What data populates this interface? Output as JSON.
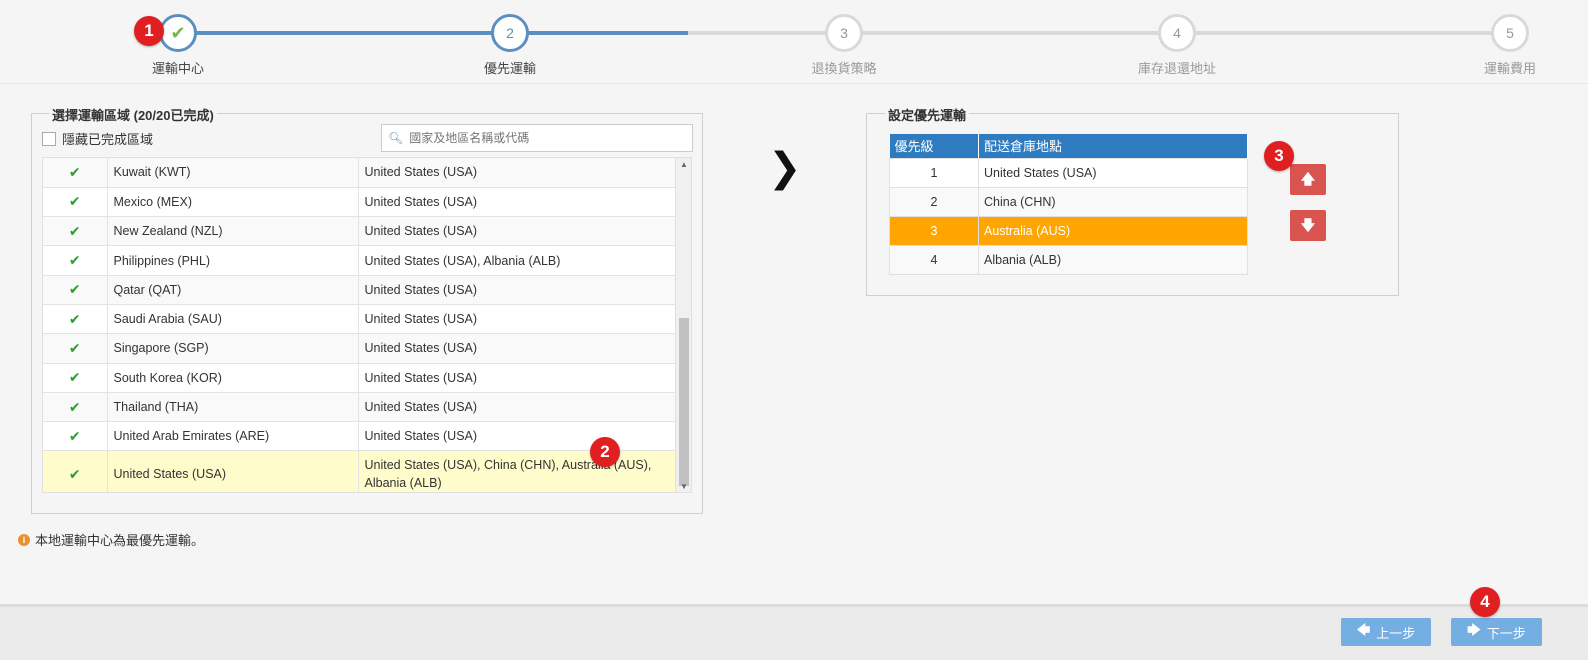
{
  "steps": [
    {
      "number": "1",
      "label": "運輸中心",
      "status": "done",
      "icon": "check-icon"
    },
    {
      "number": "2",
      "label": "優先運輸",
      "status": "active"
    },
    {
      "number": "3",
      "label": "退換貨策略",
      "status": "todo"
    },
    {
      "number": "4",
      "label": "庫存退還地址",
      "status": "todo"
    },
    {
      "number": "5",
      "label": "運輸費用",
      "status": "todo"
    }
  ],
  "markers": [
    "1",
    "2",
    "3",
    "4"
  ],
  "left_panel": {
    "legend": "選擇運輸區域 (20/20已完成)",
    "hide_completed_label": "隱藏已完成區域",
    "search_placeholder": "國家及地區名稱或代碼",
    "rows": [
      {
        "check": "✔",
        "name": "Kuwait (KWT)",
        "warehouses": "United States (USA)"
      },
      {
        "check": "✔",
        "name": "Mexico (MEX)",
        "warehouses": "United States (USA)"
      },
      {
        "check": "✔",
        "name": "New Zealand (NZL)",
        "warehouses": "United States (USA)"
      },
      {
        "check": "✔",
        "name": "Philippines (PHL)",
        "warehouses": "United States (USA), Albania (ALB)"
      },
      {
        "check": "✔",
        "name": "Qatar (QAT)",
        "warehouses": "United States (USA)"
      },
      {
        "check": "✔",
        "name": "Saudi Arabia (SAU)",
        "warehouses": "United States (USA)"
      },
      {
        "check": "✔",
        "name": "Singapore (SGP)",
        "warehouses": "United States (USA)"
      },
      {
        "check": "✔",
        "name": "South Korea (KOR)",
        "warehouses": "United States (USA)"
      },
      {
        "check": "✔",
        "name": "Thailand (THA)",
        "warehouses": "United States (USA)"
      },
      {
        "check": "✔",
        "name": "United Arab Emirates (ARE)",
        "warehouses": "United States (USA)"
      },
      {
        "check": "✔",
        "name": "United States (USA)",
        "warehouses": "United States (USA), China (CHN), Australia (AUS), Albania (ALB)"
      }
    ]
  },
  "info_note": "本地運輸中心為最優先運輸。",
  "right_panel": {
    "legend": "設定優先運輸",
    "columns": [
      "優先級",
      "配送倉庫地點"
    ],
    "rows": [
      {
        "priority": "1",
        "location": "United States (USA)"
      },
      {
        "priority": "2",
        "location": "China (CHN)"
      },
      {
        "priority": "3",
        "location": "Australia (AUS)"
      },
      {
        "priority": "4",
        "location": "Albania (ALB)"
      }
    ],
    "selected_priority": "3",
    "move_up_icon": "🡅",
    "move_down_icon": "🡇"
  },
  "footer": {
    "prev_label": "上一步",
    "next_label": "下一步",
    "prev_icon": "🡄",
    "next_icon": "🡆"
  },
  "colors": {
    "accent": "#5b8fc0",
    "header_blue": "#2e7bbf",
    "selected_orange": "#ffa500",
    "move_button_red": "#d9534f",
    "nav_button_blue": "#74aee3",
    "marker_red": "#e02020",
    "row_highlight": "#fffccc"
  }
}
